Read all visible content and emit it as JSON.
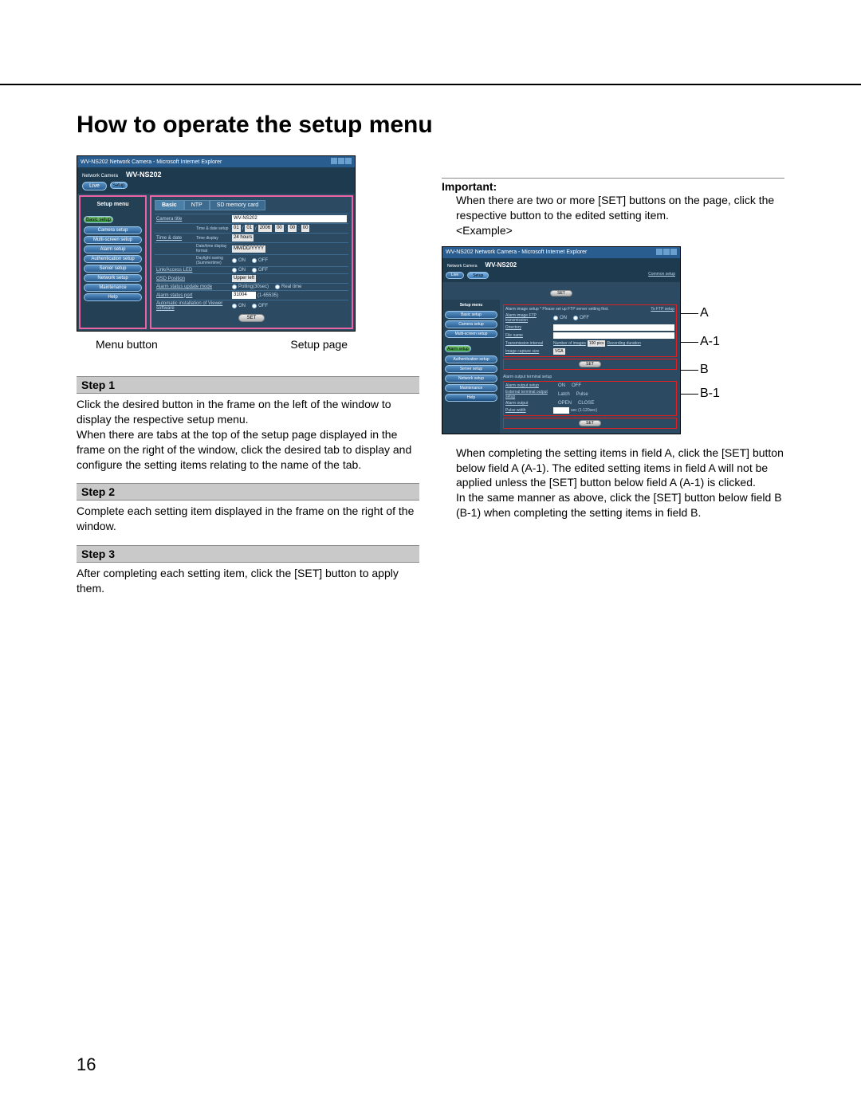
{
  "page_title": "How to operate the setup menu",
  "page_number": "16",
  "screenshot1": {
    "titlebar": "WV-NS202 Network Camera - Microsoft Internet Explorer",
    "brand": "Network Camera",
    "model": "WV-NS202",
    "topbtns": {
      "live": "Live",
      "setup": "Setup"
    },
    "sidebar_head": "Setup menu",
    "menu": {
      "basic": "Basic setup",
      "camera": "Camera setup",
      "multi": "Multi-screen setup",
      "alarm": "Alarm setup",
      "auth": "Authentication setup",
      "server": "Server setup",
      "network": "Network setup",
      "maint": "Maintenance",
      "help": "Help"
    },
    "tabs": {
      "basic": "Basic",
      "ntp": "NTP",
      "sd": "SD memory card"
    },
    "rows": {
      "camera_title_lbl": "Camera title",
      "camera_title_val": "WV-NS202",
      "time_date_lbl": "Time & date",
      "tds_lbl": "Time & date setup",
      "date_parts": [
        "01",
        "/",
        "01",
        "/",
        "2006",
        "  ",
        "00",
        ":",
        "00",
        ":",
        "00"
      ],
      "time_disp_lbl": "Time display",
      "time_disp_val": "24 hours",
      "dt_fmt_lbl": "Date/time display format",
      "dt_fmt_val": "MM/DD/YYYY",
      "dst_lbl": "Daylight saving (Summertime)",
      "on": "ON",
      "off": "OFF",
      "led_lbl": "Link/Access LED",
      "osd_lbl": "OSD Position",
      "osd_val": "Upper left",
      "alarm_mode_lbl": "Alarm status update mode",
      "alarm_mode_poll": "Polling(30sec)",
      "alarm_mode_rt": "Real time",
      "alarm_port_lbl": "Alarm status port",
      "alarm_port_val": "31004",
      "alarm_port_range": "(1-65535)",
      "autoinst_lbl": "Automatic installation of Viewer software"
    },
    "set": "SET"
  },
  "caption": {
    "left": "Menu button",
    "right": "Setup page"
  },
  "steps": {
    "s1h": "Step 1",
    "s1": "Click the desired button in the frame on the left of the window to display the respective setup menu.\nWhen there are tabs at the top of the setup page displayed in the frame on the right of the window, click the desired tab to display and configure the setting items relating to the name of the tab.",
    "s2h": "Step 2",
    "s2": "Complete each setting item displayed in the frame on the right of the window.",
    "s3h": "Step 3",
    "s3": "After completing each setting item, click the [SET] button to apply them."
  },
  "important": {
    "head": "Important:",
    "body": "When there are two or more [SET] buttons on the page, click the respective button to the edited setting item.",
    "example": "<Example>",
    "after": "When completing the setting items in field A, click the [SET] button below field A (A-1). The edited setting items in field A will not be applied unless the [SET] button below field A (A-1) is clicked.\nIn the same manner as above, click the [SET] button below field B (B-1) when completing the setting items in field B."
  },
  "screenshot2": {
    "titlebar": "WV-NS202 Network Camera - Microsoft Internet Explorer",
    "brand": "Network Camera",
    "model": "WV-NS202",
    "topbtns": {
      "live": "Live",
      "setup": "Setup"
    },
    "sidebar_head": "Setup menu",
    "menu": {
      "basic": "Basic setup",
      "camera": "Camera setup",
      "multi": "Multi-screen setup",
      "alarm": "Alarm setup",
      "auth": "Authentication setup",
      "server": "Server setup",
      "network": "Network setup",
      "maint": "Maintenance",
      "help": "Help"
    },
    "section_a": {
      "head": "Alarm image setup     * Please set up FTP server setting first.",
      "link": "To FTP setup",
      "ftp_lbl": "Alarm image FTP transmission",
      "on": "ON",
      "off": "OFF",
      "dir_lbl": "Directory",
      "file_lbl": "File name",
      "trans_lbl": "Transmission interval",
      "num_lbl": "Number of images",
      "dur_lbl": "Recording duration",
      "num_val": "100 pics",
      "cap_lbl": "Image capture size",
      "cap_val": "VGA"
    },
    "section_b": {
      "head": "Alarm output terminal setup",
      "out_lbl": "Alarm output setup",
      "on": "ON",
      "off": "OFF",
      "term_lbl": "External terminal output setup",
      "term_v1": "Latch",
      "term_v2": "Pulse",
      "ao_lbl": "Alarm output",
      "ao_v1": "OPEN",
      "ao_v2": "CLOSE",
      "pw_lbl": "Pulse width",
      "pw_val": "",
      "pw_unit": "sec (1-120sec)"
    },
    "set": "SET"
  },
  "callouts": {
    "A": "A",
    "A1": "A-1",
    "B": "B",
    "B1": "B-1"
  }
}
